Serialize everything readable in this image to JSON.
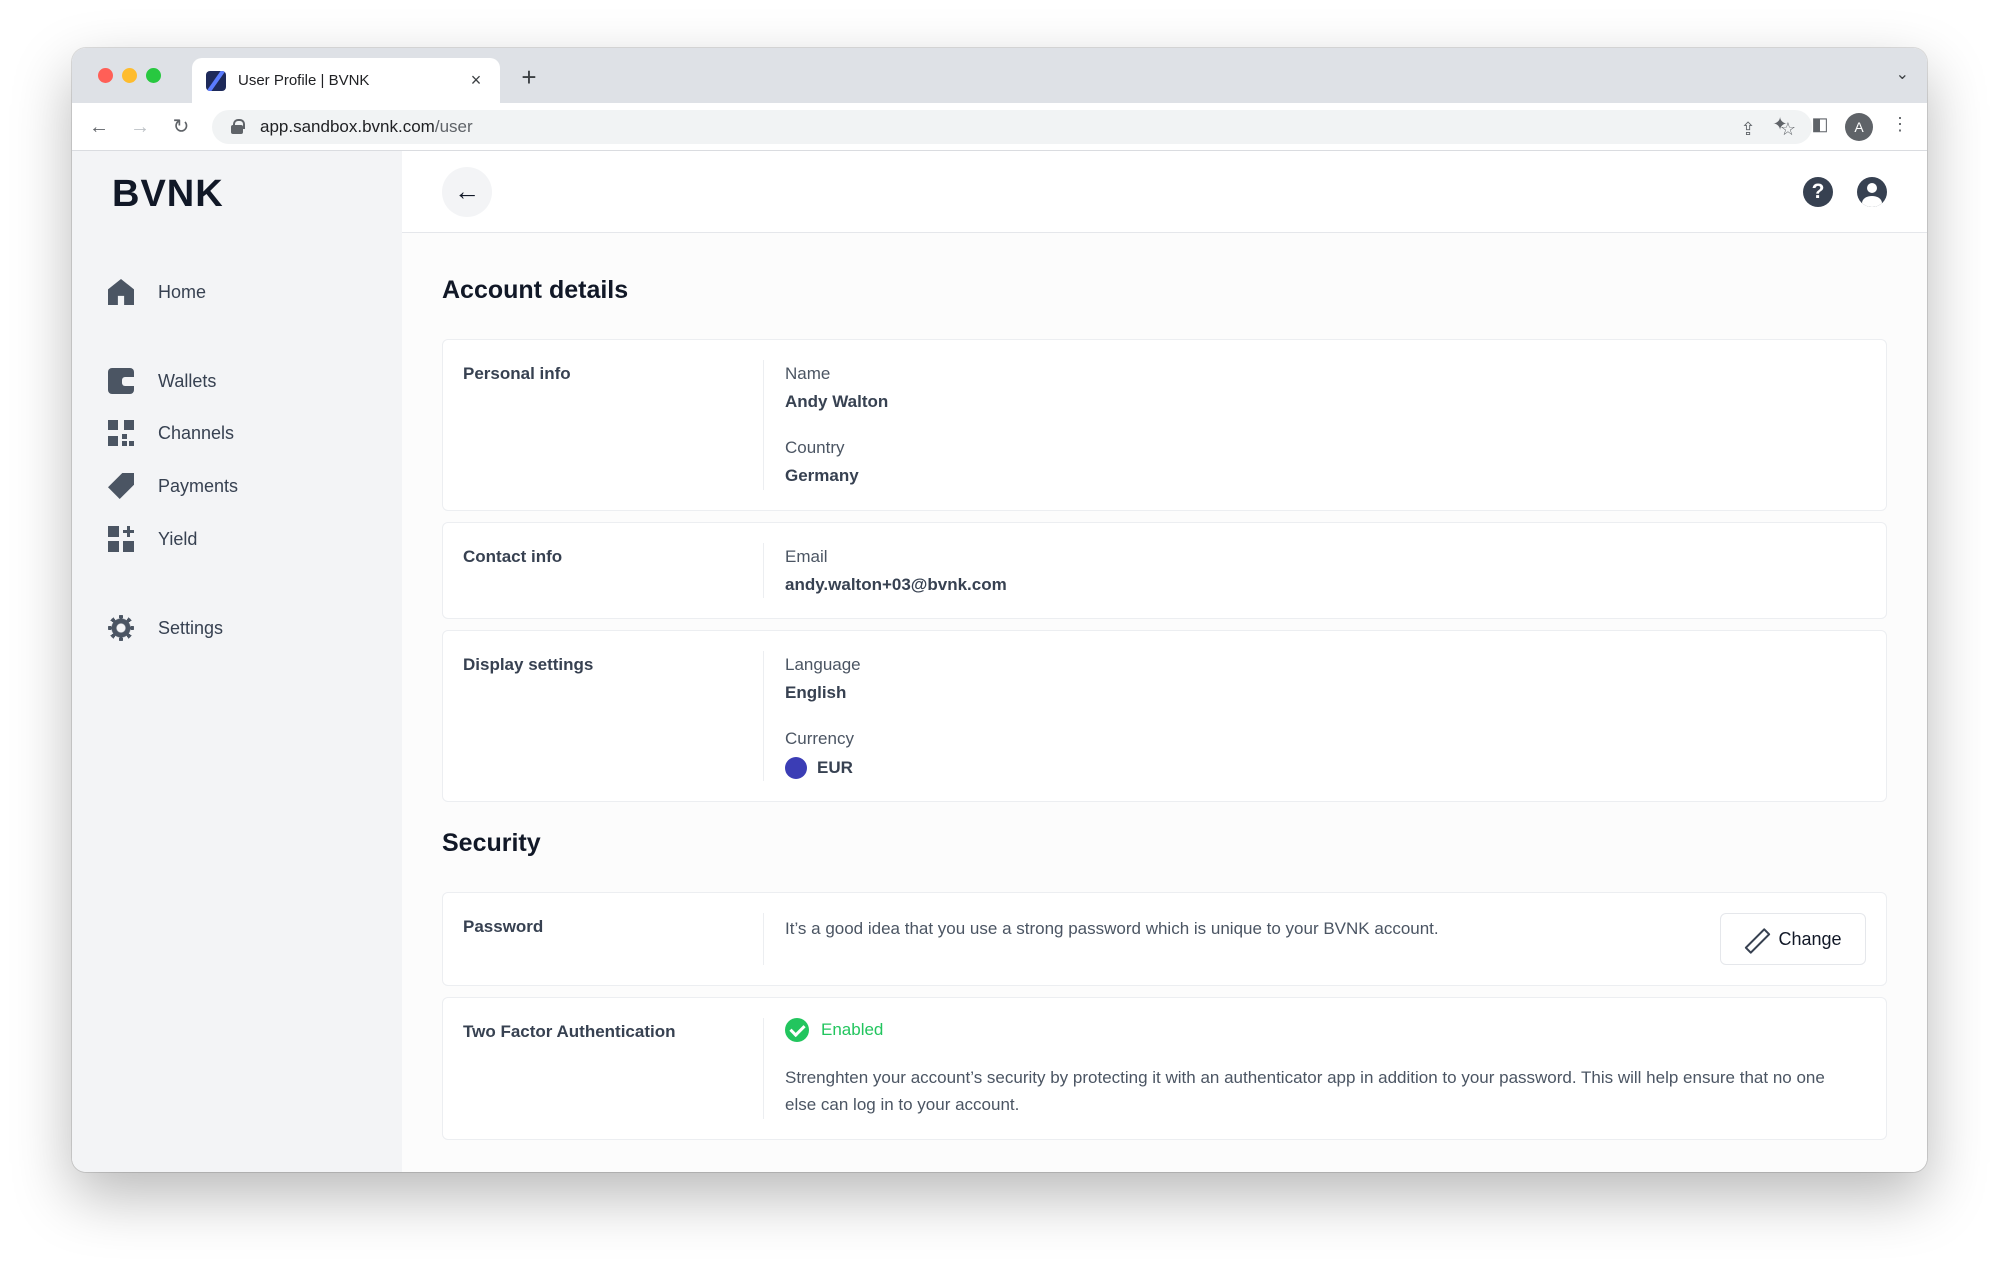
{
  "browser": {
    "tab_title": "User Profile | BVNK",
    "tab_close": "×",
    "new_tab": "+",
    "tab_menu": "⌄",
    "url_host": "app.sandbox.bvnk.com",
    "url_path": "/user",
    "avatar_letter": "A"
  },
  "sidebar": {
    "logo": "BVNK",
    "items": [
      {
        "label": "Home",
        "icon": "home-icon"
      },
      {
        "label": "Wallets",
        "icon": "wallet-icon"
      },
      {
        "label": "Channels",
        "icon": "channels-icon"
      },
      {
        "label": "Payments",
        "icon": "tag-icon"
      },
      {
        "label": "Yield",
        "icon": "yield-icon"
      },
      {
        "label": "Settings",
        "icon": "gear-icon"
      }
    ]
  },
  "header": {
    "back_glyph": "←",
    "help_glyph": "?"
  },
  "account": {
    "title": "Account details",
    "personal": {
      "label": "Personal info",
      "name_label": "Name",
      "name_value": "Andy Walton",
      "country_label": "Country",
      "country_value": "Germany"
    },
    "contact": {
      "label": "Contact info",
      "email_label": "Email",
      "email_value": "andy.walton+03@bvnk.com"
    },
    "display": {
      "label": "Display settings",
      "language_label": "Language",
      "language_value": "English",
      "currency_label": "Currency",
      "currency_value": "EUR",
      "currency_color": "#3b3db5"
    }
  },
  "security": {
    "title": "Security",
    "password": {
      "label": "Password",
      "text": "It’s a good idea that you use a strong password which is unique to your BVNK account.",
      "button": "Change"
    },
    "tfa": {
      "label": "Two Factor Authentication",
      "status": "Enabled",
      "status_color": "#22c55e",
      "text": "Strenghten your account’s security by protecting it with an authenticator app in addition to your password. This will help ensure that no one else can log in to your account."
    }
  }
}
